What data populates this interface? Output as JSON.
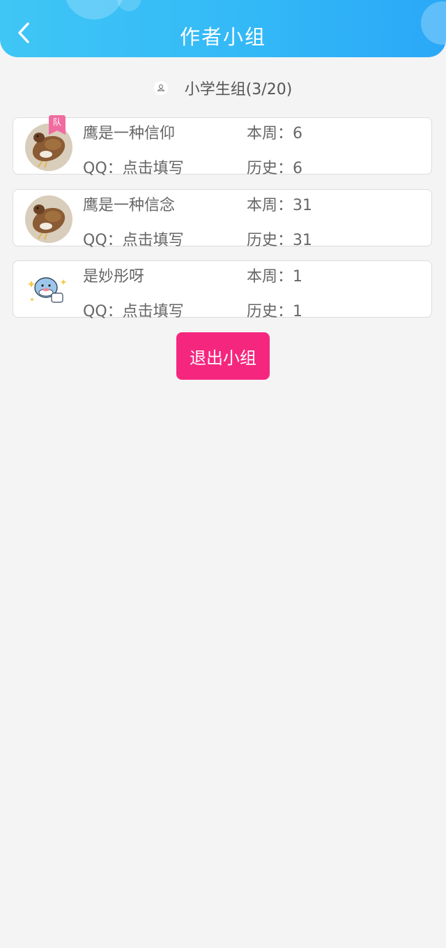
{
  "header": {
    "title": "作者小组",
    "back_icon": "chevron-left-icon"
  },
  "group": {
    "icon": "group-icon",
    "name": "小学生组(3/20)"
  },
  "labels": {
    "qq": "QQ：",
    "week": "本周：",
    "history": "历史："
  },
  "members": [
    {
      "nickname": "鹰是一种信仰",
      "qq": "点击填写",
      "week": "6",
      "history": "6",
      "avatar": "eagle-avatar",
      "badge": "队"
    },
    {
      "nickname": "鹰是一种信念",
      "qq": "点击填写",
      "week": "31",
      "history": "31",
      "avatar": "eagle-avatar"
    },
    {
      "nickname": "是妙彤呀",
      "qq": "点击填写",
      "week": "1",
      "history": "1",
      "avatar": "cartoon-dolphin-avatar"
    }
  ],
  "exit_button": "退出小组",
  "colors": {
    "header_start": "#3fc6f5",
    "header_end": "#2aa8f7",
    "exit_button": "#f5267e",
    "badge": "#f06ca0",
    "background": "#f4f4f4"
  }
}
